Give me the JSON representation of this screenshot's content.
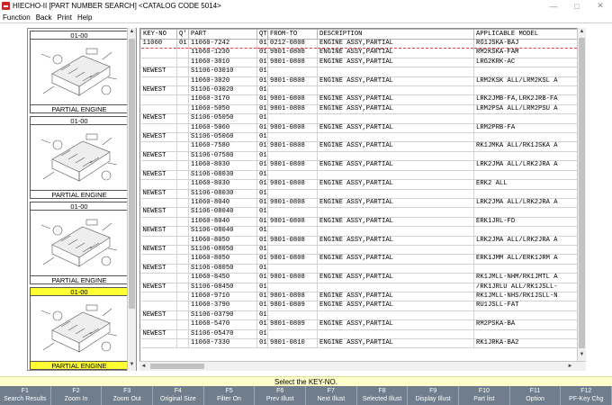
{
  "window": {
    "title": "HIECHO-II [PART NUMBER SEARCH] <CATALOG CODE 5014>",
    "minimize": "—",
    "maximize": "□",
    "close": "✕"
  },
  "menu": [
    "Function",
    "Back",
    "Print",
    "Help"
  ],
  "thumbnails": [
    {
      "code": "01-00",
      "caption": "PARTIAL ENGINE",
      "selected": false
    },
    {
      "code": "01-00",
      "caption": "PARTIAL ENGINE",
      "selected": false
    },
    {
      "code": "01-00",
      "caption": "PARTIAL ENGINE",
      "selected": false
    },
    {
      "code": "01-00",
      "caption": "PARTIAL ENGINE",
      "selected": true
    }
  ],
  "grid": {
    "headers": [
      "KEY-NO",
      "Q'",
      "PART",
      "QT",
      "FROM-TO",
      "DESCRIPTION",
      "APPLICABLE MODEL"
    ],
    "rows": [
      [
        "11060",
        "01",
        "11060-7242",
        "01",
        "0212-0808",
        "ENGINE ASSY,PARTIAL",
        "RG1JSKA-BAJ"
      ],
      [
        "",
        "",
        "11060-1230",
        "01",
        "9801-0808",
        "ENGINE ASSY,PARTIAL",
        "RM2KSKA-FAM"
      ],
      [
        "",
        "",
        "11060-3010",
        "01",
        "9801-0808",
        "ENGINE ASSY,PARTIAL",
        "LRG2KRK-AC"
      ],
      [
        "NEWEST",
        "",
        "S1106-03010",
        "01",
        "",
        "",
        ""
      ],
      [
        "",
        "",
        "11060-3020",
        "01",
        "9801-0808",
        "ENGINE ASSY,PARTIAL",
        "LRM2KSK ALL/LRM2KSL A"
      ],
      [
        "NEWEST",
        "",
        "S1106-03020",
        "01",
        "",
        "",
        ""
      ],
      [
        "",
        "",
        "11060-3170",
        "01",
        "9801-0808",
        "ENGINE ASSY,PARTIAL",
        "LRK2JMB-FA,LRK2JRB-FA"
      ],
      [
        "",
        "",
        "11060-5050",
        "01",
        "9801-0808",
        "ENGINE ASSY,PARTIAL",
        "LRM2PSA ALL/LRM2PSU A"
      ],
      [
        "NEWEST",
        "",
        "S1106-05050",
        "01",
        "",
        "",
        ""
      ],
      [
        "",
        "",
        "11060-5060",
        "01",
        "9801-0808",
        "ENGINE ASSY,PARTIAL",
        "LRM2PRB-FA"
      ],
      [
        "NEWEST",
        "",
        "S1106-05060",
        "01",
        "",
        "",
        ""
      ],
      [
        "",
        "",
        "11060-7580",
        "01",
        "9801-0808",
        "ENGINE ASSY,PARTIAL",
        "RK1JMKA ALL/RK1JSKA A"
      ],
      [
        "NEWEST",
        "",
        "S1106-07580",
        "01",
        "",
        "",
        ""
      ],
      [
        "",
        "",
        "11060-8030",
        "01",
        "9801-0808",
        "ENGINE ASSY,PARTIAL",
        "LRK2JMA ALL/LRK2JRA A"
      ],
      [
        "NEWEST",
        "",
        "S1106-08030",
        "01",
        "",
        "",
        ""
      ],
      [
        "",
        "",
        "11060-8030",
        "01",
        "9801-0808",
        "ENGINE ASSY,PARTIAL",
        "ERK2 ALL"
      ],
      [
        "NEWEST",
        "",
        "S1106-08030",
        "01",
        "",
        "",
        ""
      ],
      [
        "",
        "",
        "11060-8040",
        "01",
        "9801-0808",
        "ENGINE ASSY,PARTIAL",
        "LRK2JMA ALL/LRK2JRA A"
      ],
      [
        "NEWEST",
        "",
        "S1106-08040",
        "01",
        "",
        "",
        ""
      ],
      [
        "",
        "",
        "11060-8040",
        "01",
        "9801-0808",
        "ENGINE ASSY,PARTIAL",
        "ERK1JRL-FD"
      ],
      [
        "NEWEST",
        "",
        "S1106-08040",
        "01",
        "",
        "",
        ""
      ],
      [
        "",
        "",
        "11060-8050",
        "01",
        "9801-0808",
        "ENGINE ASSY,PARTIAL",
        "LRK2JMA ALL/LRK2JRA A"
      ],
      [
        "NEWEST",
        "",
        "S1106-08050",
        "01",
        "",
        "",
        ""
      ],
      [
        "",
        "",
        "11060-8050",
        "01",
        "9801-0808",
        "ENGINE ASSY,PARTIAL",
        "ERK1JMM ALL/ERK1JRM A"
      ],
      [
        "NEWEST",
        "",
        "S1106-08050",
        "01",
        "",
        "",
        ""
      ],
      [
        "",
        "",
        "11060-8450",
        "01",
        "9801-0808",
        "ENGINE ASSY,PARTIAL",
        "RK1JMLL-NHM/RK1JMTL A"
      ],
      [
        "NEWEST",
        "",
        "S1106-08450",
        "01",
        "",
        "",
        "/RK1JRLU ALL/RK1JSLL-"
      ],
      [
        "",
        "",
        "11060-9710",
        "01",
        "9801-0808",
        "ENGINE ASSY,PARTIAL",
        "RK1JMLL-NHS/RK1JSLL-N"
      ],
      [
        "",
        "",
        "11060-3790",
        "01",
        "9801-0809",
        "ENGINE ASSY,PARTIAL",
        "RU1JSLL-FAT"
      ],
      [
        "NEWEST",
        "",
        "S1106-03790",
        "01",
        "",
        "",
        ""
      ],
      [
        "",
        "",
        "11060-5470",
        "01",
        "9801-0809",
        "ENGINE ASSY,PARTIAL",
        "RM2PSKA-BA"
      ],
      [
        "NEWEST",
        "",
        "S1106-05470",
        "01",
        "",
        "",
        ""
      ],
      [
        "",
        "",
        "11060-7330",
        "01",
        "9801-0810",
        "ENGINE ASSY,PARTIAL",
        "RK1JRKA-BA2"
      ]
    ]
  },
  "status": "Select the KEY-NO.",
  "fkeys": [
    {
      "key": "F1",
      "label": "Search Results"
    },
    {
      "key": "F2",
      "label": "Zoom In"
    },
    {
      "key": "F3",
      "label": "Zoom Out"
    },
    {
      "key": "F4",
      "label": "Original Size"
    },
    {
      "key": "F5",
      "label": "Filter On"
    },
    {
      "key": "F6",
      "label": "Prev Illust"
    },
    {
      "key": "F7",
      "label": "Next Illust"
    },
    {
      "key": "F8",
      "label": "Selected Illust"
    },
    {
      "key": "F9",
      "label": "Display Illust"
    },
    {
      "key": "F10",
      "label": "Part list"
    },
    {
      "key": "F11",
      "label": "Option"
    },
    {
      "key": "F12",
      "label": "PF-Key Chg"
    }
  ]
}
